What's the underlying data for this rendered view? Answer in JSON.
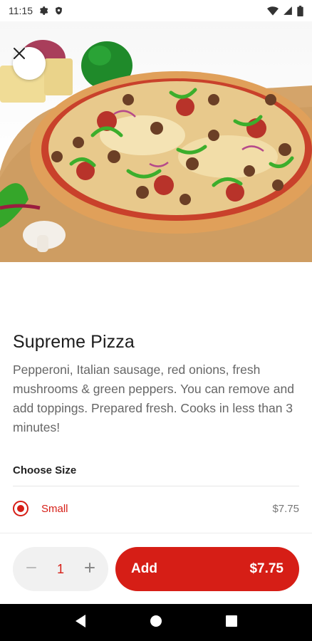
{
  "status_bar": {
    "time": "11:15"
  },
  "product": {
    "title": "Supreme Pizza",
    "description": "Pepperoni, Italian sausage, red onions, fresh mushrooms & green peppers. You can remove and add toppings. Prepared fresh. Cooks in less than 3 minutes!"
  },
  "size_section": {
    "label": "Choose Size",
    "options": [
      {
        "label": "Small",
        "price": "$7.75",
        "selected": true
      }
    ]
  },
  "cart": {
    "quantity": "1",
    "add_label": "Add",
    "add_price": "$7.75"
  },
  "colors": {
    "accent": "#d61e16",
    "qty_bg": "#f1f1f1"
  },
  "icons": {
    "close": "close-icon",
    "minus": "minus-icon",
    "plus": "plus-icon",
    "back": "back-icon",
    "home": "home-icon",
    "recents": "recents-icon"
  }
}
